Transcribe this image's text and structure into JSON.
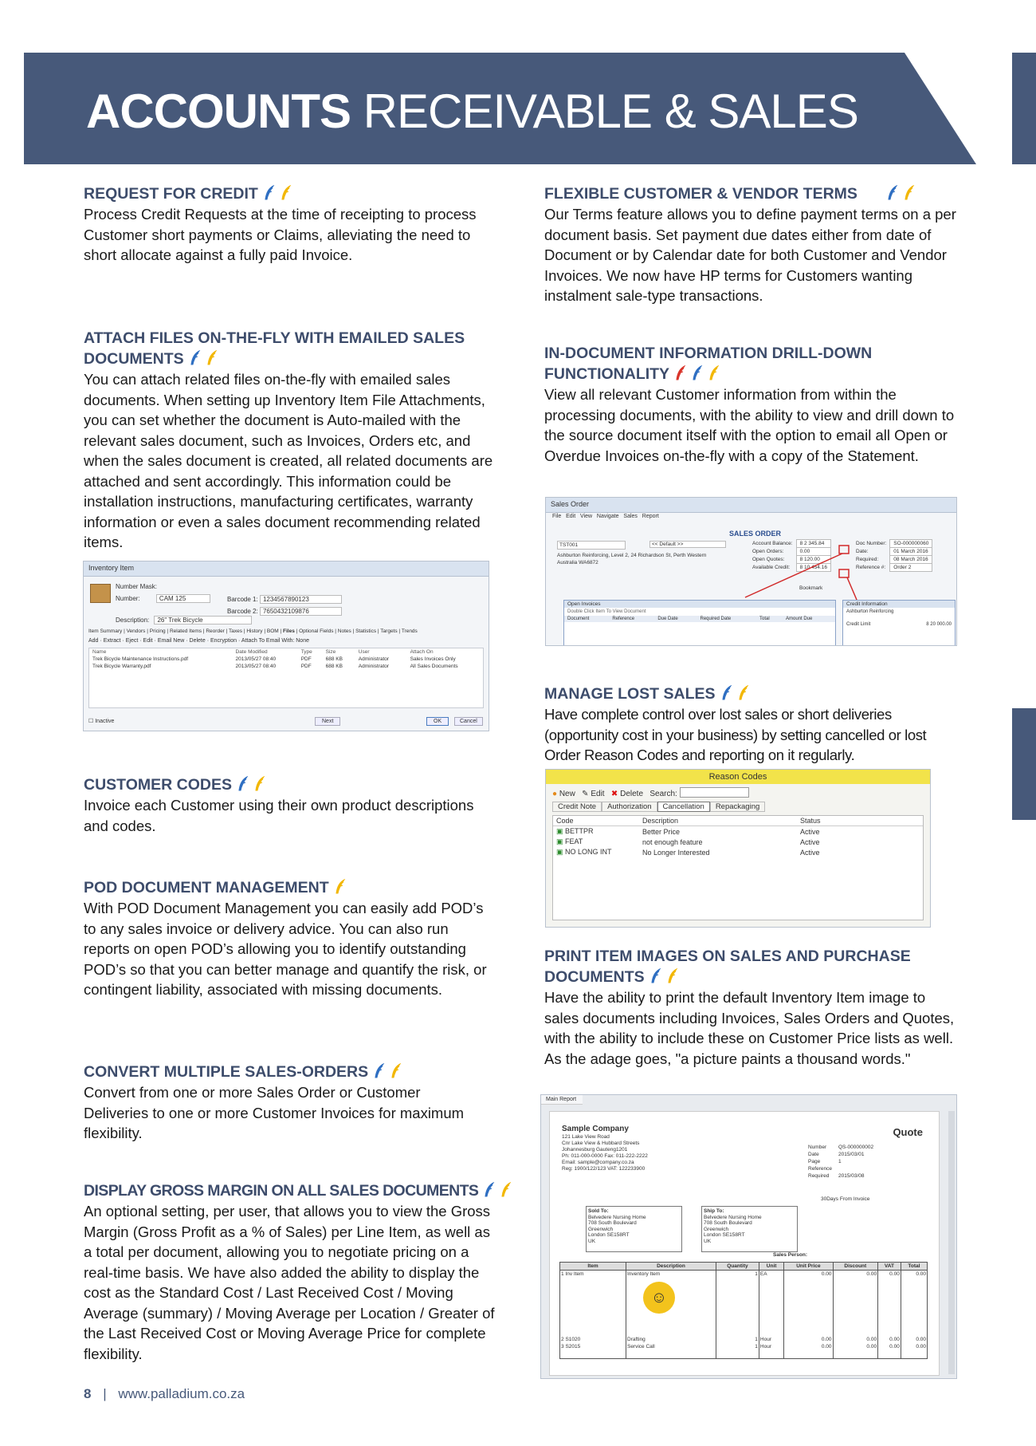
{
  "header": {
    "title_bold": "ACCOUNTS",
    "title_rest": "RECEIVABLE & SALES"
  },
  "sections": {
    "request_credit": {
      "title": "REQUEST FOR CREDIT",
      "body": "Process Credit Requests at the time of receipting to process Customer short payments or Claims, alleviating the need to short allocate against a fully paid Invoice."
    },
    "flexible_terms": {
      "title": "FLEXIBLE CUSTOMER & VENDOR TERMS",
      "body": "Our Terms feature allows you to define payment terms on a per document basis. Set payment due dates either from date of Document or by Calendar date for both Customer and Vendor Invoices. We now have HP terms for Customers wanting instalment sale-type transactions."
    },
    "attach_files": {
      "title": "ATTACH FILES ON-THE-FLY WITH EMAILED SALES DOCUMENTS",
      "body": "You can attach related files on-the-fly with emailed sales documents. When setting up Inventory Item File Attachments, you can set whether the document is Auto-mailed with the relevant sales document, such as Invoices, Orders etc, and when the sales document is created, all related documents are attached and sent accordingly. This information could be installation instructions, manufacturing certificates, warranty information or even a sales document recommending related items."
    },
    "drill_down": {
      "title": "IN-DOCUMENT INFORMATION DRILL-DOWN FUNCTIONALITY",
      "body": "View all relevant Customer information from within the processing documents, with the ability to view and drill down to the source document itself with the option to email all Open or Overdue Invoices on-the-fly with a copy of the Statement."
    },
    "lost_sales": {
      "title": "MANAGE LOST SALES",
      "body": "Have complete control over lost sales or short deliveries (opportunity cost in your business) by setting cancelled or lost Order Reason Codes and reporting on it regularly."
    },
    "customer_codes": {
      "title": "CUSTOMER CODES",
      "body": "Invoice each Customer using their own product descriptions and codes."
    },
    "pod": {
      "title": "POD DOCUMENT MANAGEMENT",
      "body": "With POD Document Management you can easily add POD’s to any sales invoice or delivery advice. You can also run reports on open POD’s allowing you to identify outstanding POD’s so that you can better manage and quantify the risk, or contingent liability, associated with missing documents."
    },
    "print_images": {
      "title": "PRINT ITEM IMAGES ON SALES AND PURCHASE DOCUMENTS",
      "body": "Have the ability to print the default Inventory Item image to sales documents including Invoices, Sales Orders and Quotes, with the ability to include these on Customer Price lists as well. As the adage goes, \"a picture paints a thousand words.\""
    },
    "convert_orders": {
      "title": "CONVERT MULTIPLE SALES-ORDERS",
      "body": "Convert from one or more Sales Order or Customer Deliveries to one or more Customer Invoices for maximum flexibility."
    },
    "gross_margin": {
      "title": "DISPLAY GROSS MARGIN ON ALL SALES DOCUMENTS",
      "body": "An optional setting, per user, that allows you to view the Gross Margin (Gross Profit as a % of Sales) per Line Item, as well as a total per document, allowing you to negotiate pricing on a real-time basis. We have also added the ability to display the cost as the Standard Cost / Last Received Cost / Moving Average (summary) / Moving Average per Location / Greater of the Last Received Cost or Moving Average Price for complete flexibility."
    }
  },
  "license_icons": {
    "request_credit": [
      "blue",
      "yellow"
    ],
    "flexible_terms": [
      "blue",
      "yellow"
    ],
    "attach_files": [
      "blue",
      "yellow"
    ],
    "drill_down": [
      "red",
      "blue",
      "yellow"
    ],
    "lost_sales": [
      "blue",
      "yellow"
    ],
    "customer_codes": [
      "blue",
      "yellow"
    ],
    "pod": [
      "yellow"
    ],
    "print_images": [
      "blue",
      "yellow"
    ],
    "convert_orders": [
      "blue",
      "yellow"
    ],
    "gross_margin": [
      "blue",
      "yellow"
    ]
  },
  "colors": {
    "banner": "#47597a",
    "heading": "#3d4c6b",
    "blue": "#2f6fc2",
    "yellow": "#f2b705",
    "red": "#d9352b"
  },
  "screenshots": {
    "inventory": {
      "title": "Inventory Item",
      "fields": [
        [
          "Number Mask:",
          ""
        ],
        [
          "Number:",
          "CAM 125"
        ],
        [
          "Description:",
          "26\" Trek Bicycle"
        ]
      ],
      "barcodes": [
        [
          "Barcode 1:",
          "1234567890123"
        ],
        [
          "Barcode 2:",
          "7650432109876"
        ]
      ],
      "tabs": [
        "Item Summary",
        "Vendors",
        "Pricing",
        "Related Items",
        "Reorder",
        "Taxes",
        "History",
        "BOM",
        "Files",
        "Optional Fields",
        "Notes",
        "Statistics",
        "Targets",
        "Trends"
      ],
      "toolbar": [
        "Add",
        "Extract",
        "Eject",
        "Edit",
        "Email New",
        "Delete",
        "Encryption",
        "Attach To Email With: None"
      ],
      "columns": [
        "Name",
        "Date Modified",
        "Type",
        "Size",
        "User",
        "Attach On"
      ],
      "rows": [
        [
          "Trek Bicycle Maintenance Instructions.pdf",
          "2013/05/27 08:40",
          "PDF",
          "688 KB",
          "Administrator",
          "Sales Invoices Only"
        ],
        [
          "Trek Bicycle Warranty.pdf",
          "2013/05/27 08:40",
          "PDF",
          "688 KB",
          "Administrator",
          "All Sales Documents"
        ]
      ],
      "inactive": "Inactive",
      "buttons": [
        "Next",
        "OK",
        "Cancel"
      ]
    },
    "sales_order": {
      "title": "Sales Order",
      "menu": [
        "File",
        "Edit",
        "View",
        "Navigate",
        "Sales",
        "Report"
      ],
      "heading": "SALES ORDER",
      "customer": "TST001",
      "ship_to": "<< Default >>",
      "address": "Ashburton Reinforcing, Level 2, 24 Richardson St, Perth Western Australia WA6872",
      "fields": [
        [
          "Account Balance:",
          "8 2 345.84"
        ],
        [
          "Open Orders:",
          "0.00"
        ],
        [
          "Open Quotes:",
          "8 120.00"
        ],
        [
          "Available Credit:",
          "8 10 454.16"
        ]
      ],
      "doc": [
        [
          "Doc Number:",
          "SO-000000060"
        ],
        [
          "Date:",
          "01 March 2016"
        ],
        [
          "Required:",
          "08 March 2016"
        ],
        [
          "Reference #:",
          "Order 2"
        ]
      ],
      "bookmark": "Bookmark",
      "open_invoices": "Open Invoices",
      "credit_information": "Credit Information",
      "credit_customer": "Ashburton Reinforcing",
      "credit_limit_label": "Credit Limit",
      "credit_limit": "8 20 000.00",
      "inv_cols": [
        "Document",
        "Reference",
        "Due Date",
        "Required Date",
        "Total",
        "Amount Due"
      ],
      "dbl_click": "Double Click Item To View Document"
    },
    "reason_codes": {
      "title": "Reason Codes",
      "toolbar": [
        "New",
        "Edit",
        "Delete",
        "Search:"
      ],
      "tabs": [
        "Credit Note",
        "Authorization",
        "Cancellation",
        "Repackaging"
      ],
      "columns": [
        "Code",
        "Description",
        "Status"
      ],
      "rows": [
        [
          "BETTPR",
          "Better Price",
          "Active"
        ],
        [
          "FEAT",
          "not enough feature",
          "Active"
        ],
        [
          "NO LONG INT",
          "No Longer Interested",
          "Active"
        ]
      ]
    },
    "quote": {
      "tab": "Main Report",
      "company": "Sample Company",
      "address": [
        "121 Lake View Road",
        "Cnr Lake View & Hubbard Streets",
        "Johannesburg Gauteng1201",
        "Ph: 011-000-0000 Fax: 011-222-2222",
        "Email: sample@company.co.za",
        "Reg: 1900/122/123 VAT: 122233900"
      ],
      "doc_type": "Quote",
      "meta": [
        [
          "Number",
          "QS-000000002"
        ],
        [
          "Date",
          "2015/03/01"
        ],
        [
          "Page",
          "1"
        ],
        [
          "Reference",
          ""
        ],
        [
          "Required",
          "2015/03/08"
        ]
      ],
      "terms": "30Days From Invoice",
      "sold_to_label": "Sold To:",
      "ship_to_label": "Ship To:",
      "sold_to": [
        "Belvedere Nursing Home",
        "708 South Boulevard",
        "Greenwich",
        "London SE158RT",
        "UK"
      ],
      "sales_person": "Sales Person:",
      "columns": [
        "Item",
        "Description",
        "Quantity",
        "Unit",
        "Unit Price",
        "Discount",
        "VAT",
        "Total"
      ],
      "rows": [
        [
          "1",
          "Inv Item",
          "Inventory Item",
          "1",
          "EA",
          "0.00",
          "0.00",
          "0.00",
          "0.00"
        ],
        [
          "2",
          "S1020",
          "Drafting",
          "1",
          "Hour",
          "0.00",
          "0.00",
          "0.00",
          "0.00"
        ],
        [
          "3",
          "S2015",
          "Service Call",
          "1",
          "Hour",
          "0.00",
          "0.00",
          "0.00",
          "0.00"
        ]
      ]
    }
  },
  "footer": {
    "page": "8",
    "separator": "|",
    "url": "www.palladium.co.za"
  }
}
